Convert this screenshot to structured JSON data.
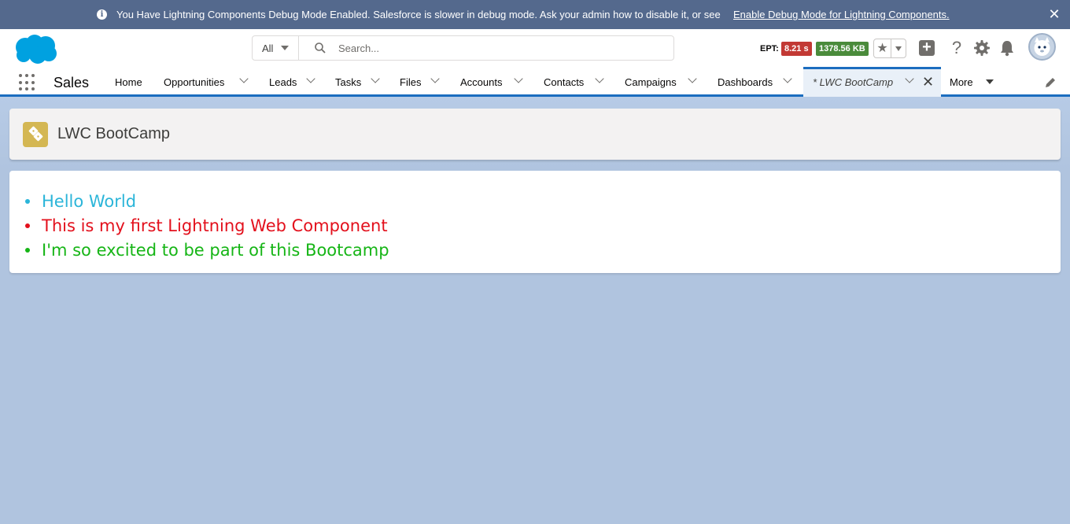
{
  "banner": {
    "message": "You Have Lightning Components Debug Mode Enabled. Salesforce is slower in debug mode. Ask your admin how to disable it, or see",
    "link": "Enable Debug Mode for Lightning Components.",
    "info_icon": "i"
  },
  "header": {
    "search_scope": "All",
    "search_placeholder": "Search...",
    "ept_label": "EPT:",
    "ept_value": "8.21 s",
    "kb_value": "1378.56 KB",
    "help_glyph": "?"
  },
  "nav": {
    "app_name": "Sales",
    "items": [
      {
        "label": "Home"
      },
      {
        "label": "Opportunities"
      },
      {
        "label": "Leads"
      },
      {
        "label": "Tasks"
      },
      {
        "label": "Files"
      },
      {
        "label": "Accounts"
      },
      {
        "label": "Contacts"
      },
      {
        "label": "Campaigns"
      },
      {
        "label": "Dashboards"
      }
    ],
    "active_tab": "* LWC BootCamp",
    "more": "More"
  },
  "page": {
    "title": "LWC BootCamp"
  },
  "card": {
    "items": [
      {
        "text": "Hello World",
        "color": "#2bb5d9"
      },
      {
        "text": "This is my first Lightning Web Component",
        "color": "#e3101c"
      },
      {
        "text": "I'm so excited to be part of this Bootcamp",
        "color": "#16b516"
      }
    ]
  },
  "colors": {
    "banner_bg": "#54698d",
    "brand_blue": "#1b6dbf",
    "ept_red": "#c23934",
    "kb_green": "#4a8b3b",
    "page_icon": "#d4b753"
  }
}
